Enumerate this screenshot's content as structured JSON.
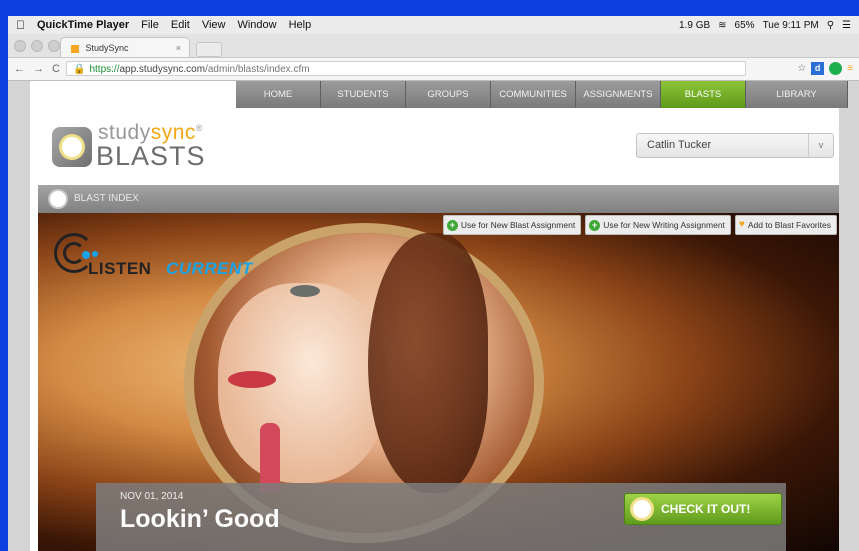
{
  "menubar": {
    "apple": "",
    "app_name": "QuickTime Player",
    "menus": [
      "File",
      "Edit",
      "View",
      "Window",
      "Help"
    ],
    "status": {
      "memory": "1.9 GB",
      "battery": "65%",
      "clock": "Tue 9:11 PM"
    }
  },
  "browser": {
    "tab_title": "StudySync",
    "tab_close": "×",
    "url_scheme": "https://",
    "url_host": "app.studysync.com",
    "url_path": "/admin/blasts/index.cfm",
    "nav": {
      "back": "←",
      "forward": "→",
      "reload": "C"
    },
    "ext_d": "d"
  },
  "site": {
    "nav": [
      {
        "label": "HOME",
        "width": 84
      },
      {
        "label": "STUDENTS",
        "width": 84
      },
      {
        "label": "GROUPS",
        "width": 84
      },
      {
        "label": "COMMUNITIES",
        "width": 84
      },
      {
        "label": "ASSIGNMENTS",
        "width": 84
      },
      {
        "label": "BLASTS",
        "width": 84,
        "active": true
      },
      {
        "label": "LIBRARY",
        "width": 101
      }
    ],
    "logo": {
      "study": "study",
      "sync": "sync",
      "reg": "®",
      "blasts": "BLASTS"
    },
    "user": "Catlin Tucker",
    "user_caret": "v",
    "section_title": "BLAST INDEX"
  },
  "hero": {
    "actions": [
      "Use for New Blast Assignment",
      "Use for New Writing Assignment",
      "Add to Blast Favorites"
    ],
    "brand_a": "LISTEN",
    "brand_b": "CURRENT",
    "date": "NOV 01, 2014",
    "title": "Lookin’ Good",
    "cta": "CHECK IT OUT!"
  },
  "colors": {
    "accent_green": "#6aa824",
    "sync_orange": "#f3a712",
    "listen_blue": "#1aa4e8"
  }
}
